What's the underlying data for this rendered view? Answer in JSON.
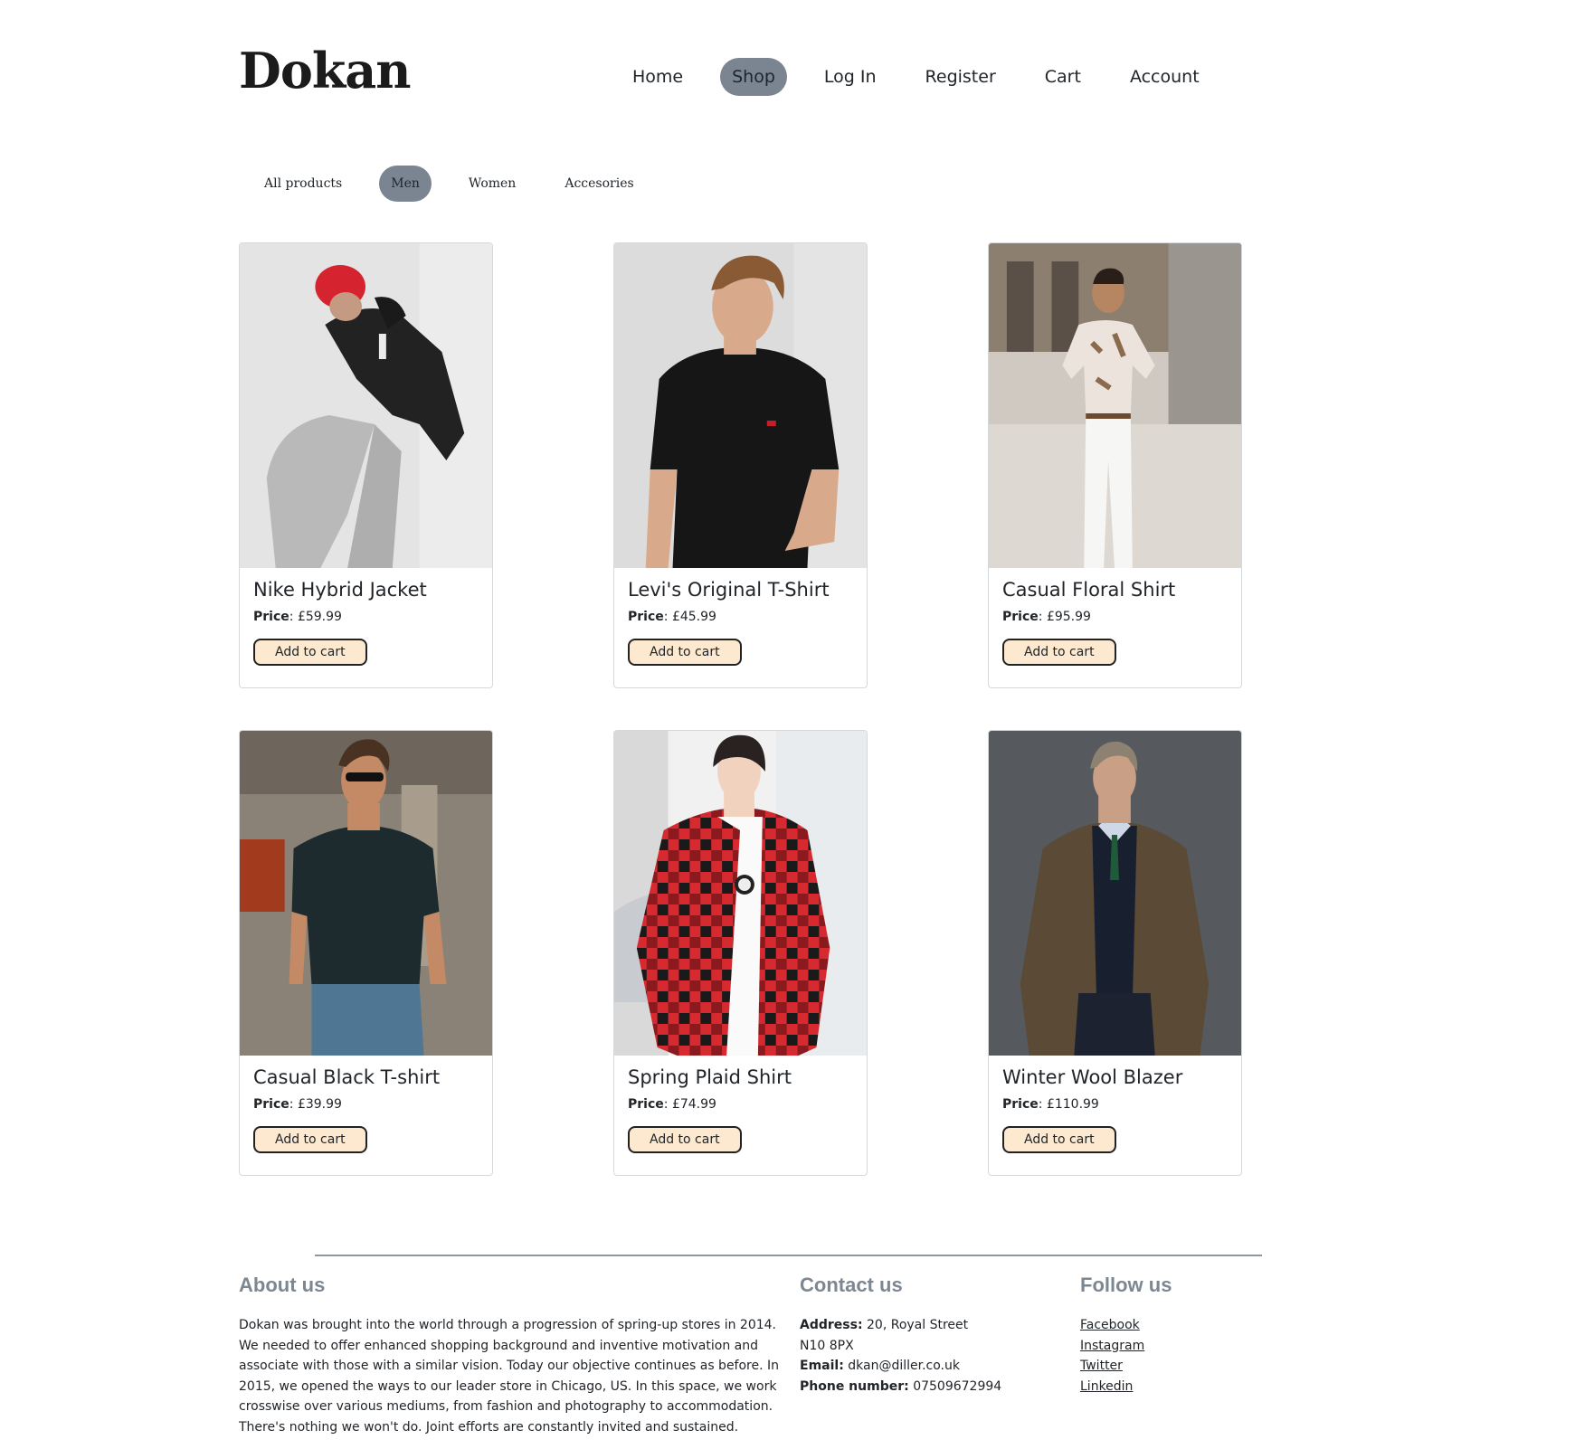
{
  "brand": "Dokan",
  "nav": [
    {
      "label": "Home",
      "active": false
    },
    {
      "label": "Shop",
      "active": true
    },
    {
      "label": "Log In",
      "active": false
    },
    {
      "label": "Register",
      "active": false
    },
    {
      "label": "Cart",
      "active": false
    },
    {
      "label": "Account",
      "active": false
    }
  ],
  "filters": [
    {
      "label": "All products",
      "active": false
    },
    {
      "label": "Men",
      "active": true
    },
    {
      "label": "Women",
      "active": false
    },
    {
      "label": "Accesories",
      "active": false
    }
  ],
  "price_label": "Price",
  "add_to_cart_label": "Add to cart",
  "products": [
    {
      "name": "Nike Hybrid Jacket",
      "price": "£59.99"
    },
    {
      "name": "Levi's Original T-Shirt",
      "price": "£45.99"
    },
    {
      "name": "Casual Floral Shirt",
      "price": "£95.99"
    },
    {
      "name": "Casual Black T-shirt",
      "price": "£39.99"
    },
    {
      "name": "Spring Plaid Shirt",
      "price": "£74.99"
    },
    {
      "name": "Winter Wool Blazer",
      "price": "£110.99"
    }
  ],
  "footer": {
    "about": {
      "heading": "About us",
      "text": "Dokan was brought into the world through a progression of spring-up stores in 2014. We needed to offer enhanced shopping background and inventive motivation and associate with those with a similar vision. Today our objective continues as before. In 2015, we opened the ways to our leader store in Chicago, US. In this space, we work crosswise over various mediums, from fashion and photography to accommodation. There's nothing we won't do. Joint efforts are constantly invited and sustained."
    },
    "contact": {
      "heading": "Contact us",
      "address_label": "Address:",
      "address_line1": "20, Royal Street",
      "address_line2": "N10 8PX",
      "email_label": "Email:",
      "email": "dkan@diller.co.uk",
      "phone_label": "Phone number:",
      "phone": "07509672994"
    },
    "follow": {
      "heading": "Follow us",
      "links": [
        "Facebook",
        "Instagram",
        "Twitter",
        "Linkedin"
      ]
    }
  },
  "colors": {
    "active_pill": "#7a8591",
    "button_bg": "#fde9d0",
    "footer_heading": "#7d8792"
  }
}
